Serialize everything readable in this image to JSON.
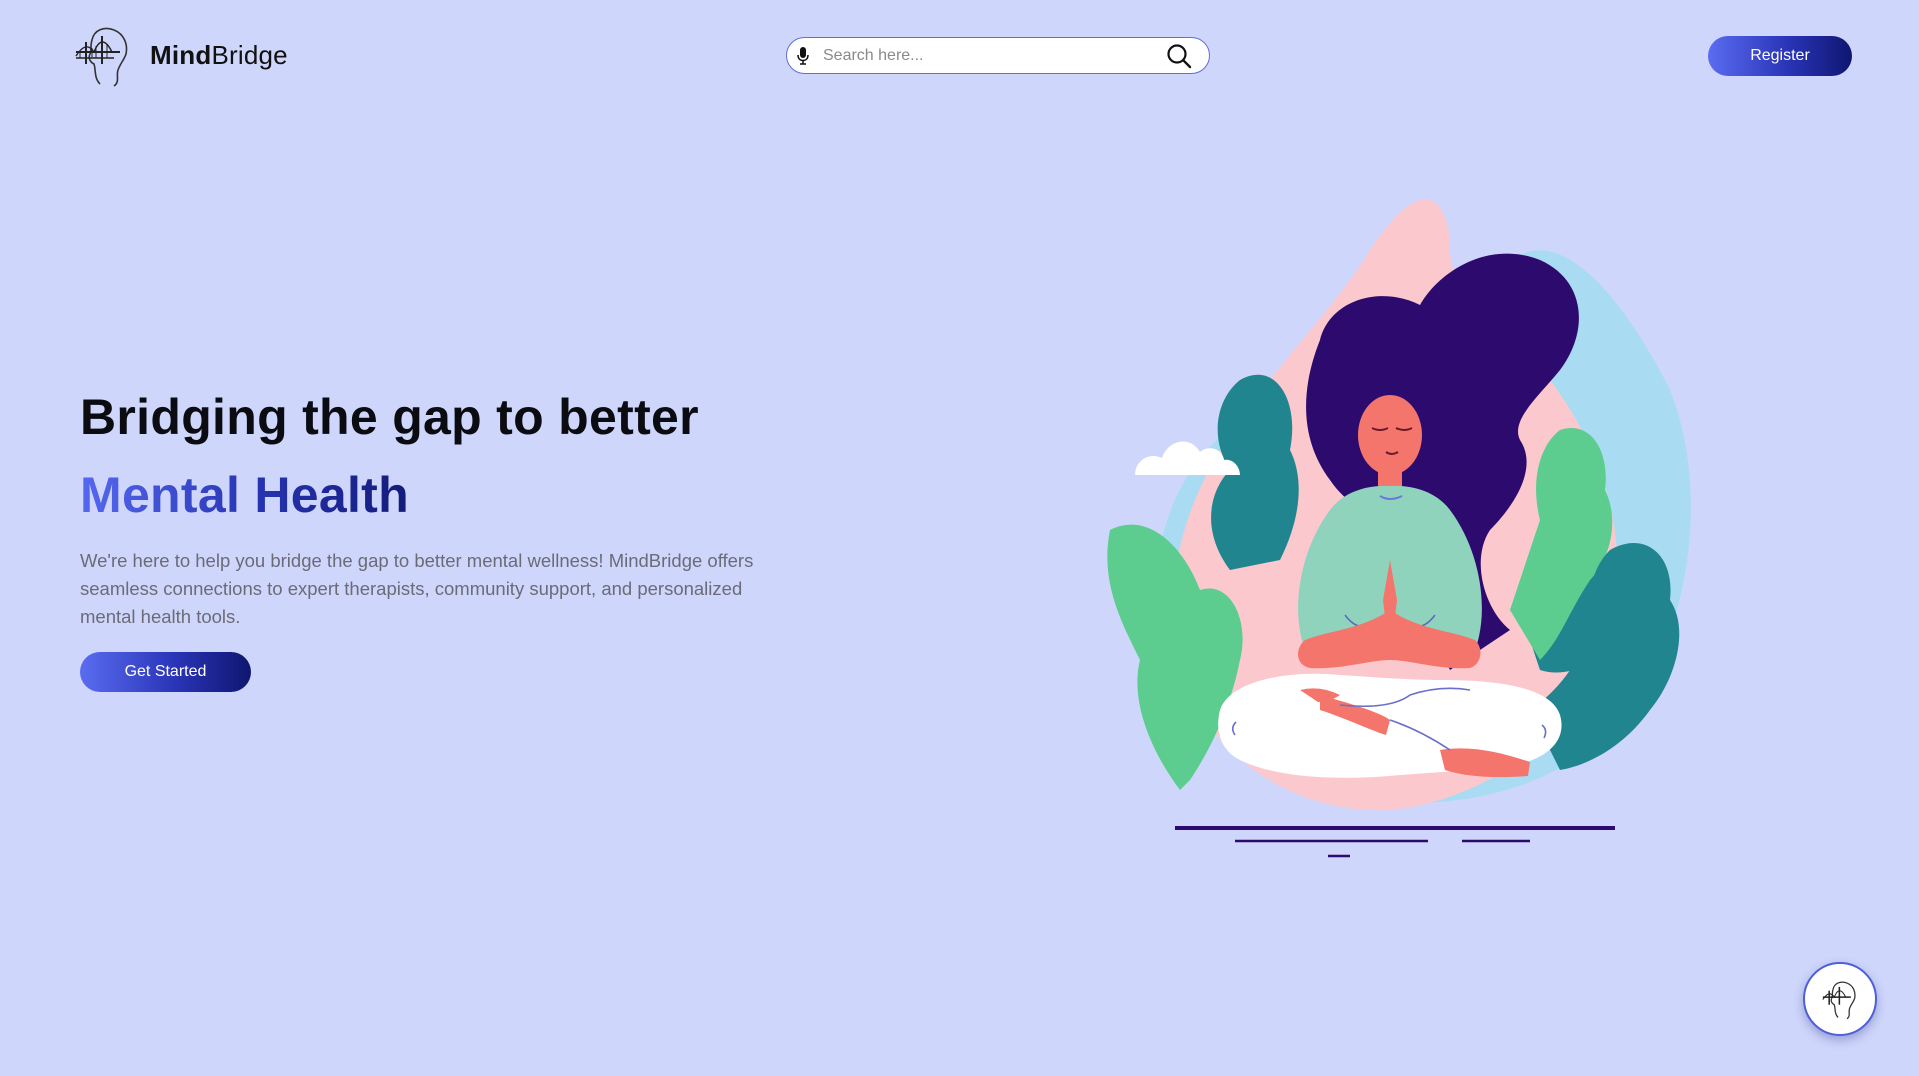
{
  "header": {
    "brand_bold": "Mind",
    "brand_light": "Bridge",
    "logo_icon": "bridge-head-logo-icon",
    "search": {
      "placeholder": "Search here...",
      "value": "",
      "mic_icon": "microphone-icon",
      "search_icon": "magnifier-icon"
    },
    "register_label": "Register"
  },
  "hero": {
    "title": "Bridging the gap to better",
    "highlight": "Mental Health",
    "description": "We're here to help you bridge the gap to better mental wellness! MindBridge offers seamless connections to expert therapists, community support, and personalized mental health tools.",
    "cta_label": "Get Started",
    "illustration": "meditating-woman-illustration"
  },
  "chat_fab": {
    "icon": "bridge-head-logo-icon"
  },
  "colors": {
    "background": "#cfd6fb",
    "accent_start": "#5a6cf0",
    "accent_end": "#0f1670",
    "text_dark": "#0b0b12",
    "text_muted": "#6b6b78"
  }
}
